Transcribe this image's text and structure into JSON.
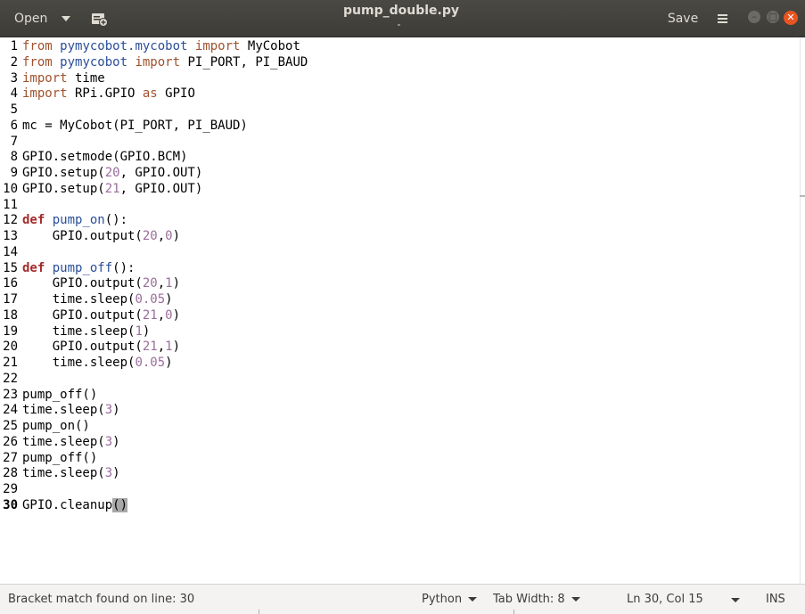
{
  "header": {
    "open_label": "Open",
    "title": "pump_double.py",
    "save_label": "Save",
    "icons": [
      "new-document-icon",
      "hamburger-menu-icon",
      "minimize-icon",
      "maximize-icon",
      "close-icon"
    ]
  },
  "editor": {
    "current_line": 30,
    "lines": [
      [
        {
          "t": "from",
          "c": "kw"
        },
        {
          "t": " "
        },
        {
          "t": "pymycobot.mycobot",
          "c": "mod"
        },
        {
          "t": " "
        },
        {
          "t": "import",
          "c": "kw"
        },
        {
          "t": " MyCobot"
        }
      ],
      [
        {
          "t": "from",
          "c": "kw"
        },
        {
          "t": " "
        },
        {
          "t": "pymycobot",
          "c": "mod"
        },
        {
          "t": " "
        },
        {
          "t": "import",
          "c": "kw"
        },
        {
          "t": " PI_PORT, PI_BAUD"
        }
      ],
      [
        {
          "t": "import",
          "c": "kw"
        },
        {
          "t": " time"
        }
      ],
      [
        {
          "t": "import",
          "c": "kw"
        },
        {
          "t": " RPi.GPIO "
        },
        {
          "t": "as",
          "c": "kw"
        },
        {
          "t": " GPIO"
        }
      ],
      [],
      [
        {
          "t": "mc = MyCobot(PI_PORT, PI_BAUD)"
        }
      ],
      [],
      [
        {
          "t": "GPIO.setmode(GPIO.BCM)"
        }
      ],
      [
        {
          "t": "GPIO.setup("
        },
        {
          "t": "20",
          "c": "num"
        },
        {
          "t": ", GPIO.OUT)"
        }
      ],
      [
        {
          "t": "GPIO.setup("
        },
        {
          "t": "21",
          "c": "num"
        },
        {
          "t": ", GPIO.OUT)"
        }
      ],
      [],
      [
        {
          "t": "def",
          "c": "kwb"
        },
        {
          "t": " "
        },
        {
          "t": "pump_on",
          "c": "fn"
        },
        {
          "t": "():"
        }
      ],
      [
        {
          "t": "    GPIO.output("
        },
        {
          "t": "20",
          "c": "num"
        },
        {
          "t": ","
        },
        {
          "t": "0",
          "c": "num"
        },
        {
          "t": ")"
        }
      ],
      [],
      [
        {
          "t": "def",
          "c": "kwb"
        },
        {
          "t": " "
        },
        {
          "t": "pump_off",
          "c": "fn"
        },
        {
          "t": "():"
        }
      ],
      [
        {
          "t": "    GPIO.output("
        },
        {
          "t": "20",
          "c": "num"
        },
        {
          "t": ","
        },
        {
          "t": "1",
          "c": "num"
        },
        {
          "t": ")"
        }
      ],
      [
        {
          "t": "    time.sleep("
        },
        {
          "t": "0.05",
          "c": "num"
        },
        {
          "t": ")"
        }
      ],
      [
        {
          "t": "    GPIO.output("
        },
        {
          "t": "21",
          "c": "num"
        },
        {
          "t": ","
        },
        {
          "t": "0",
          "c": "num"
        },
        {
          "t": ")"
        }
      ],
      [
        {
          "t": "    time.sleep("
        },
        {
          "t": "1",
          "c": "num"
        },
        {
          "t": ")"
        }
      ],
      [
        {
          "t": "    GPIO.output("
        },
        {
          "t": "21",
          "c": "num"
        },
        {
          "t": ","
        },
        {
          "t": "1",
          "c": "num"
        },
        {
          "t": ")"
        }
      ],
      [
        {
          "t": "    time.sleep("
        },
        {
          "t": "0.05",
          "c": "num"
        },
        {
          "t": ")"
        }
      ],
      [],
      [
        {
          "t": "pump_off()"
        }
      ],
      [
        {
          "t": "time.sleep("
        },
        {
          "t": "3",
          "c": "num"
        },
        {
          "t": ")"
        }
      ],
      [
        {
          "t": "pump_on()"
        }
      ],
      [
        {
          "t": "time.sleep("
        },
        {
          "t": "3",
          "c": "num"
        },
        {
          "t": ")"
        }
      ],
      [
        {
          "t": "pump_off()"
        }
      ],
      [
        {
          "t": "time.sleep("
        },
        {
          "t": "3",
          "c": "num"
        },
        {
          "t": ")"
        }
      ],
      [],
      [
        {
          "t": "GPIO.cleanup"
        },
        {
          "t": "()",
          "c": "bm"
        }
      ]
    ]
  },
  "statusbar": {
    "message": "Bracket match found on line: 30",
    "language": "Python",
    "tab_width": "Tab Width: 8",
    "position": "Ln 30, Col 15",
    "mode": "INS"
  },
  "colors": {
    "header_bg": "#3d3c37",
    "keyword": "#a0522d",
    "keyword_def": "#a52a2a",
    "module_function": "#2a4f98",
    "number": "#9a6e9a",
    "close_button": "#e95420"
  }
}
